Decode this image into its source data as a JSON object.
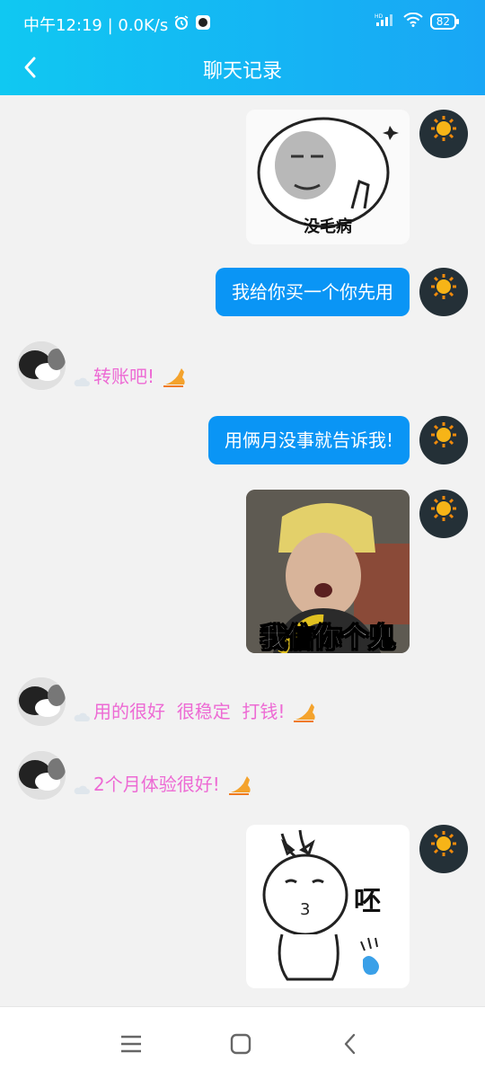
{
  "status": {
    "time_speed": "中午12:19 | 0.0K/s",
    "signal_badge": "HD",
    "battery": "82"
  },
  "header": {
    "title": "聊天记录",
    "back_icon": "chevron-left-icon"
  },
  "messages": [
    {
      "side": "me",
      "kind": "sticker",
      "caption": "没毛病"
    },
    {
      "side": "me",
      "kind": "text",
      "text": "我给你买一个你先用"
    },
    {
      "side": "other",
      "kind": "text",
      "text": "转账吧!"
    },
    {
      "side": "me",
      "kind": "text",
      "text": "用俩月没事就告诉我!"
    },
    {
      "side": "me",
      "kind": "sticker",
      "caption": "我信你个鬼"
    },
    {
      "side": "other",
      "kind": "text",
      "text": "用的很好  很稳定  打钱!"
    },
    {
      "side": "other",
      "kind": "text",
      "text": "2个月体验很好!"
    },
    {
      "side": "me",
      "kind": "sticker",
      "caption": "呸"
    }
  ],
  "colors": {
    "header_start": "#10c8f2",
    "header_end": "#19a6f5",
    "bubble_blue": "#0a95f5",
    "pink_text": "#ed6ad4",
    "background": "#f2f2f2"
  },
  "nav": {
    "menu_icon": "menu-icon",
    "home_icon": "home-square-icon",
    "back_icon": "back-chevron-icon"
  }
}
